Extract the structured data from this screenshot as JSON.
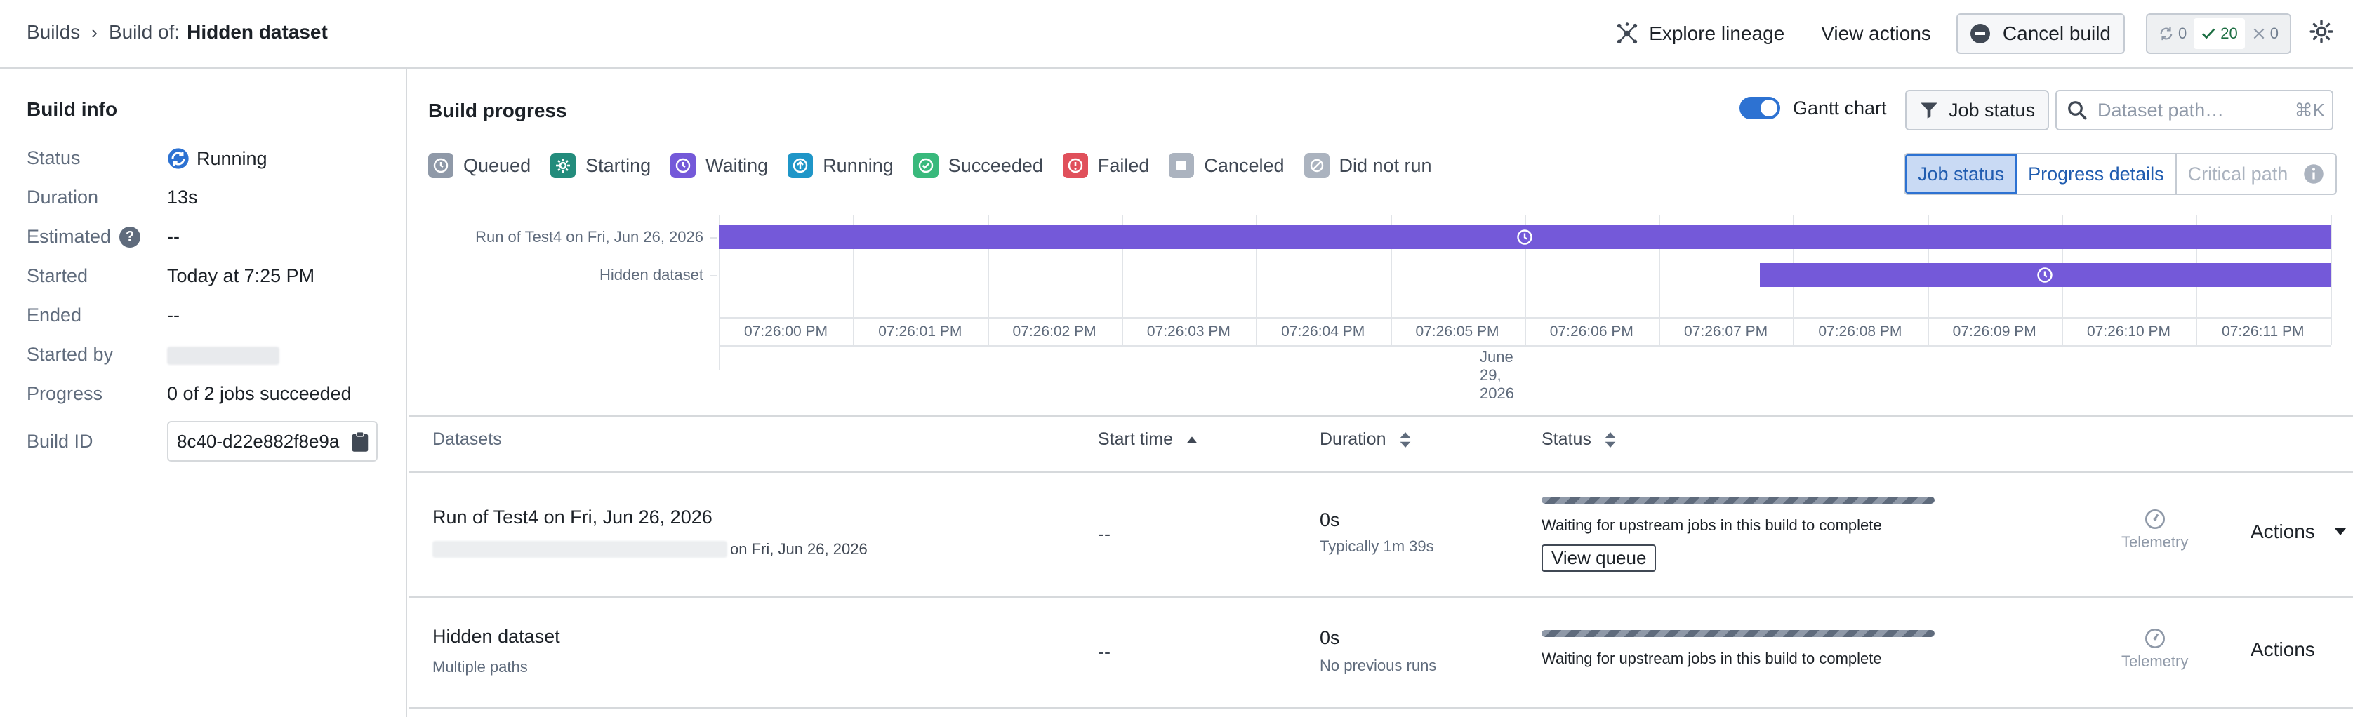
{
  "breadcrumb": {
    "root": "Builds",
    "prefix": "Build of:",
    "current": "Hidden dataset"
  },
  "toolbar": {
    "explore_lineage": "Explore lineage",
    "view_actions": "View actions",
    "cancel_build": "Cancel build",
    "counts": {
      "running": "0",
      "succeeded": "20",
      "failed": "0"
    }
  },
  "build_info": {
    "title": "Build info",
    "rows": [
      {
        "label": "Status",
        "value": "Running"
      },
      {
        "label": "Duration",
        "value": "13s"
      },
      {
        "label": "Estimated",
        "value": "--"
      },
      {
        "label": "Started",
        "value": "Today at 7:25 PM"
      },
      {
        "label": "Ended",
        "value": "--"
      },
      {
        "label": "Started by",
        "value": ""
      },
      {
        "label": "Progress",
        "value": "0 of 2 jobs succeeded"
      },
      {
        "label": "Build ID",
        "value": "8c40-d22e882f8e9a"
      }
    ]
  },
  "build_progress": {
    "title": "Build progress",
    "gantt_toggle_label": "Gantt chart",
    "gantt_enabled": true,
    "job_status_filter": "Job status",
    "search_placeholder": "Dataset path…",
    "search_shortcut": "⌘K",
    "legend": [
      {
        "label": "Queued",
        "color": "#8f99a8",
        "icon": "clock-icon"
      },
      {
        "label": "Starting",
        "color": "#238c7c",
        "icon": "gear-icon"
      },
      {
        "label": "Waiting",
        "color": "#7459d9",
        "icon": "clock-icon"
      },
      {
        "label": "Running",
        "color": "#1f96c8",
        "icon": "arrow-up-icon"
      },
      {
        "label": "Succeeded",
        "color": "#39b97c",
        "icon": "check-icon"
      },
      {
        "label": "Failed",
        "color": "#e0505b",
        "icon": "exclamation-icon"
      },
      {
        "label": "Canceled",
        "color": "#abb3bf",
        "icon": "square-icon"
      },
      {
        "label": "Did not run",
        "color": "#abb3bf",
        "icon": "slash-icon"
      }
    ],
    "views": [
      "Job status",
      "Progress details",
      "Critical path"
    ],
    "active_view": "Job status"
  },
  "gantt": {
    "rows": [
      {
        "label": "Run of Test4 on Fri, Jun 26, 2026",
        "start_tick": 0,
        "end_tick": 12,
        "status": "Waiting"
      },
      {
        "label": "Hidden dataset",
        "start_tick": 7.75,
        "end_tick": 12,
        "status": "Waiting"
      }
    ],
    "ticks": [
      "07:26:00 PM",
      "07:26:01 PM",
      "07:26:02 PM",
      "07:26:03 PM",
      "07:26:04 PM",
      "07:26:05 PM",
      "07:26:06 PM",
      "07:26:07 PM",
      "07:26:08 PM",
      "07:26:09 PM",
      "07:26:10 PM",
      "07:26:11 PM"
    ],
    "date": "June 29, 2026",
    "bar_color": "#7459d9"
  },
  "table": {
    "headers": {
      "datasets": "Datasets",
      "start_time": "Start time",
      "duration": "Duration",
      "status": "Status"
    },
    "rows": [
      {
        "name": "Run of Test4 on Fri, Jun 26, 2026",
        "sub": "on Fri, Jun 26, 2026",
        "start_time": "--",
        "duration": "0s",
        "duration_sub": "Typically 1m 39s",
        "status_text": "Waiting for upstream jobs in this build to complete",
        "status_action": "View queue",
        "telemetry": "Telemetry",
        "actions": "Actions"
      },
      {
        "name": "Hidden dataset",
        "sub": "Multiple paths",
        "start_time": "--",
        "duration": "0s",
        "duration_sub": "No previous runs",
        "status_text": "Waiting for upstream jobs in this build to complete",
        "telemetry": "Telemetry",
        "actions": "Actions"
      }
    ]
  }
}
